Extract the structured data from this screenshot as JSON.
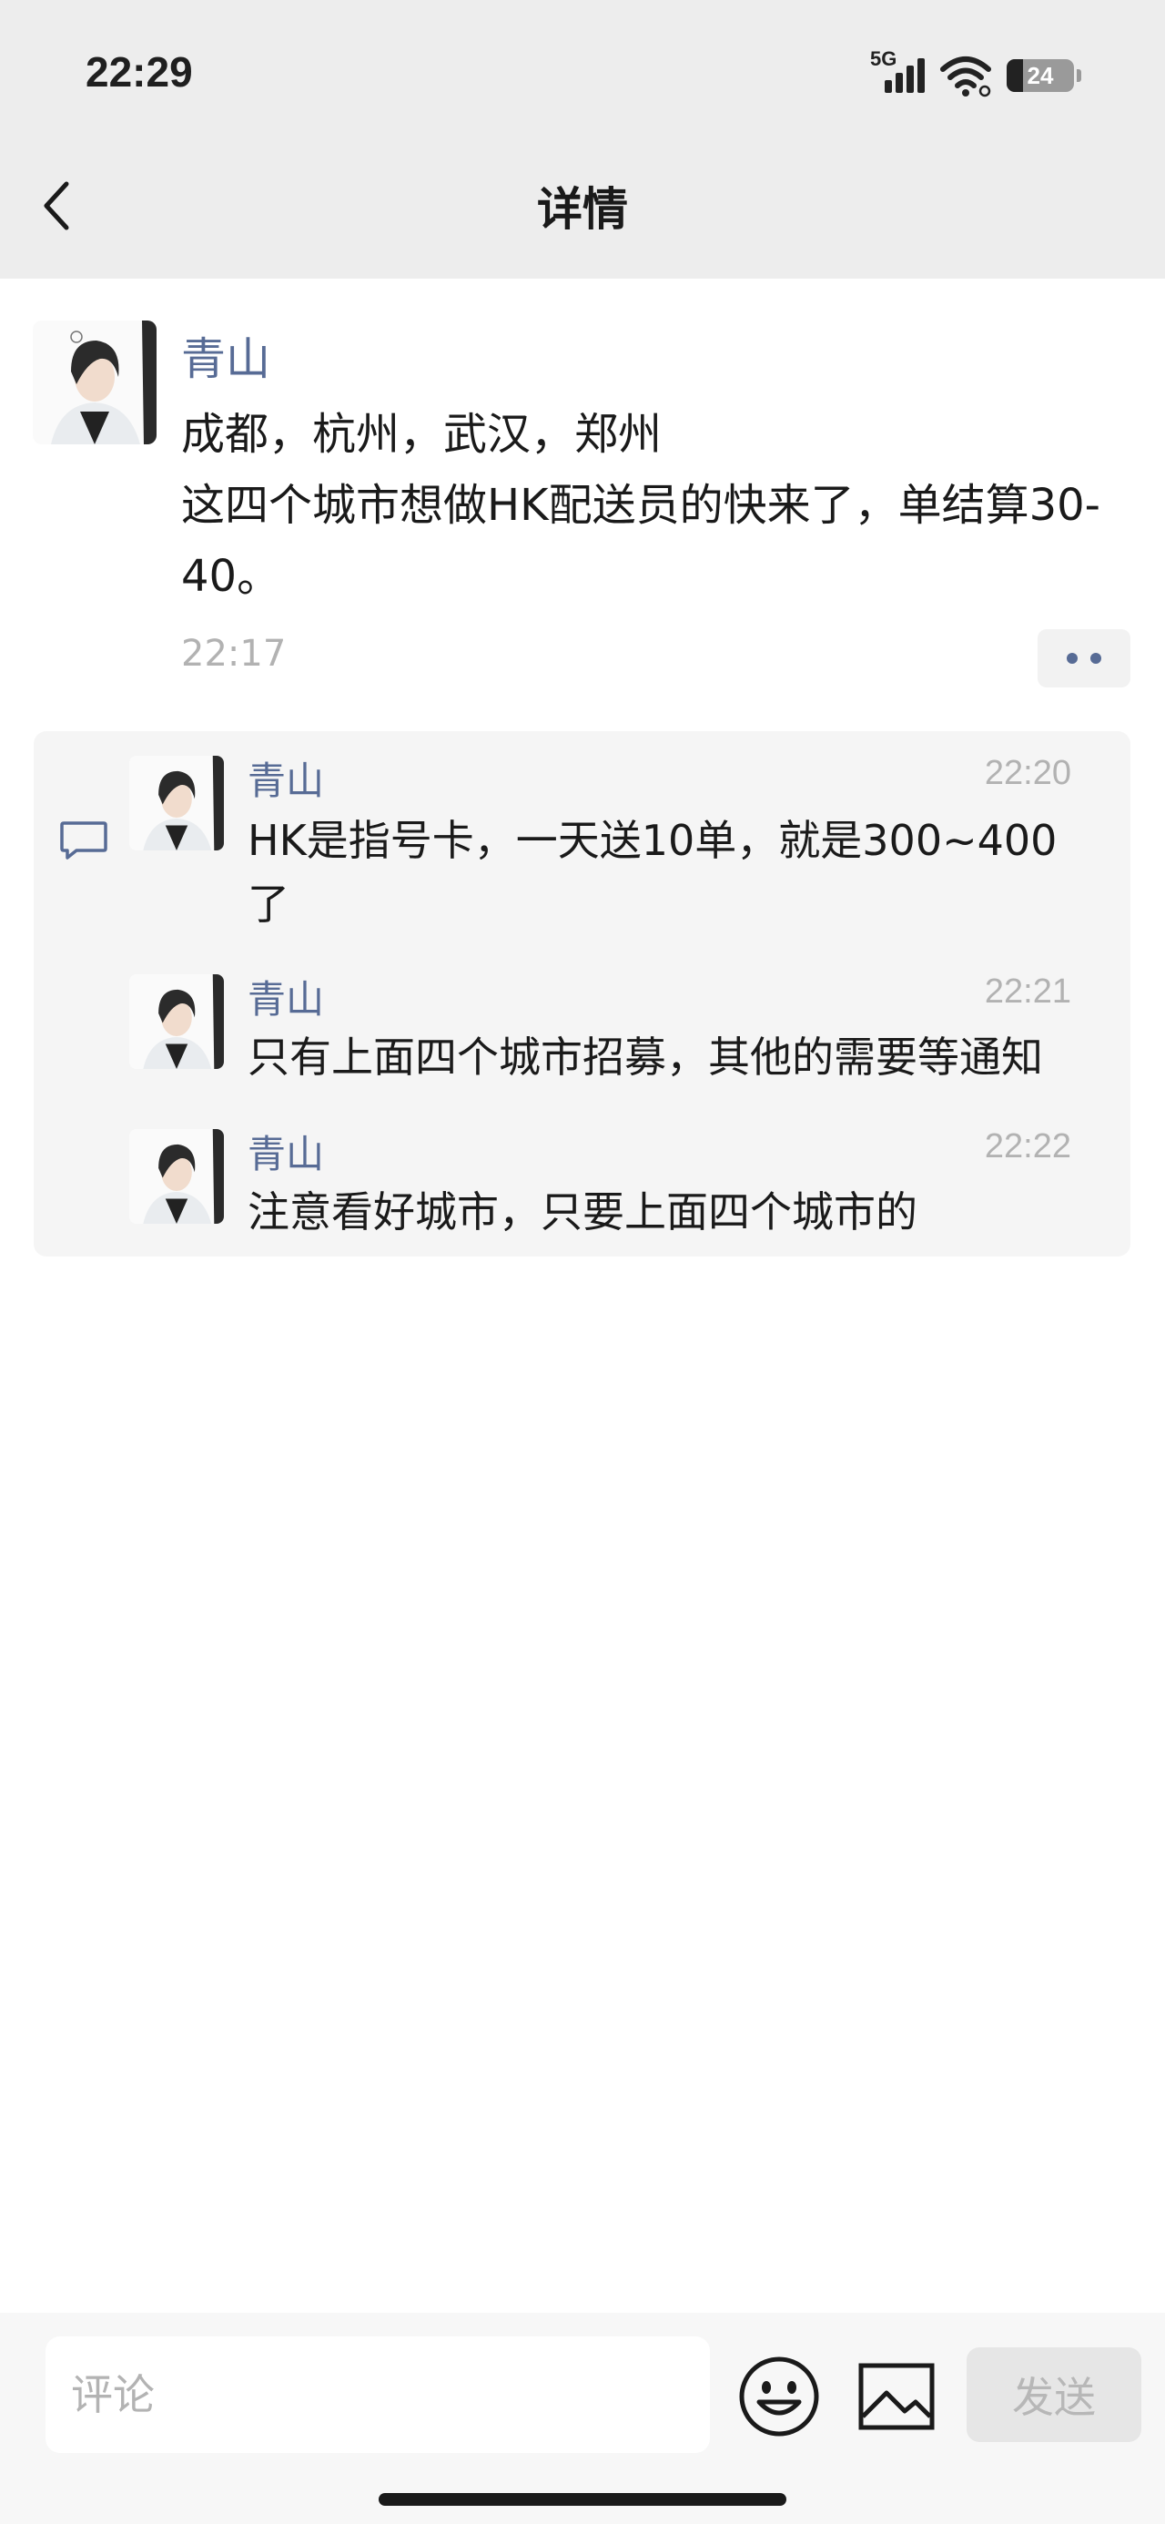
{
  "status_bar": {
    "time": "22:29",
    "network": "5G",
    "battery": "24",
    "battery_level_percent": 24
  },
  "header": {
    "title": "详情",
    "back_icon": "chevron-left-icon"
  },
  "post": {
    "author": "青山",
    "body": "成都，杭州，武汉，郑州\n这四个城市想做HK配送员的快来了，单结算30-40。",
    "time": "22:17",
    "more_icon": "more-dots-icon"
  },
  "comments": {
    "icon": "comment-icon",
    "items": [
      {
        "author": "青山",
        "time": "22:20",
        "text": "HK是指号卡，一天送10单，就是300~400了"
      },
      {
        "author": "青山",
        "time": "22:21",
        "text": "只有上面四个城市招募，其他的需要等通知"
      },
      {
        "author": "青山",
        "time": "22:22",
        "text": "注意看好城市，只要上面四个城市的"
      }
    ]
  },
  "input_bar": {
    "placeholder": "评论",
    "emoji_icon": "emoji-smile-icon",
    "image_icon": "image-icon",
    "send_label": "发送"
  },
  "colors": {
    "name_link": "#576b95",
    "header_bg": "#ededed",
    "muted_text": "#b2b2b2",
    "comment_bg": "#f5f5f5"
  }
}
